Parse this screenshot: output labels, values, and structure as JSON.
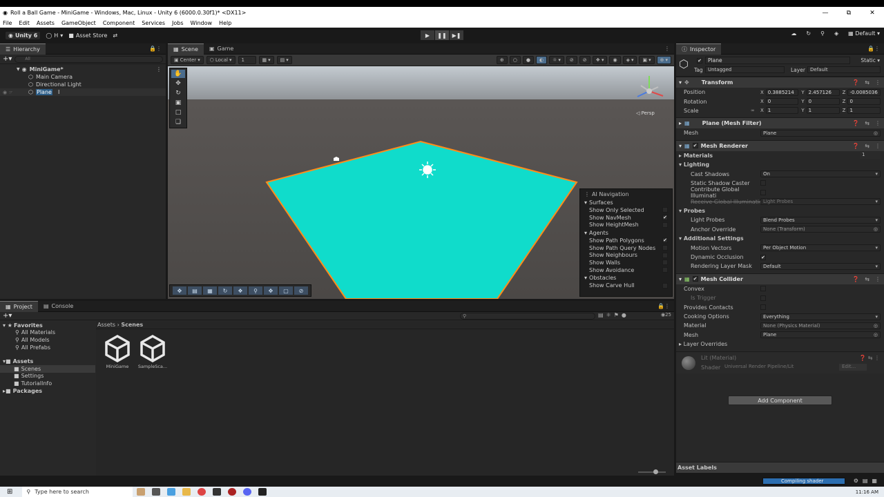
{
  "window": {
    "title": "Roll a Ball Game - MiniGame - Windows, Mac, Linux - Unity 6 (6000.0.30f1)* <DX11>",
    "min": "—",
    "max": "⧉",
    "close": "✕"
  },
  "menu": [
    "File",
    "Edit",
    "Assets",
    "GameObject",
    "Component",
    "Services",
    "Jobs",
    "Window",
    "Help"
  ],
  "toolbar": {
    "unity": "Unity 6",
    "account": "H",
    "asset_store": "Asset Store",
    "layout": "Default"
  },
  "hierarchy": {
    "tab": "Hierarchy",
    "search_placeholder": "All",
    "items": [
      {
        "label": "MiniGame*"
      },
      {
        "label": "Main Camera"
      },
      {
        "label": "Directional Light"
      },
      {
        "label": "Plane"
      }
    ]
  },
  "scene": {
    "tabs": [
      "Scene",
      "Game"
    ],
    "pivot": "Center",
    "space": "Local",
    "grid": "1",
    "persp": "◁ Persp"
  },
  "ainav": {
    "title": "AI Navigation",
    "surfaces": "Surfaces",
    "agents": "Agents",
    "obstacles": "Obstacles",
    "surface_opts": [
      {
        "label": "Show Only Selected",
        "checked": ""
      },
      {
        "label": "Show NavMesh",
        "checked": "✔"
      },
      {
        "label": "Show HeightMesh",
        "checked": ""
      }
    ],
    "agent_opts": [
      {
        "label": "Show Path Polygons",
        "checked": "✔"
      },
      {
        "label": "Show Path Query Nodes",
        "checked": ""
      },
      {
        "label": "Show Neighbours",
        "checked": ""
      },
      {
        "label": "Show Walls",
        "checked": ""
      },
      {
        "label": "Show Avoidance",
        "checked": ""
      }
    ],
    "obstacle_opts": [
      {
        "label": "Show Carve Hull",
        "checked": ""
      }
    ]
  },
  "inspector": {
    "tab": "Inspector",
    "object_name": "Plane",
    "static": "Static",
    "tag_label": "Tag",
    "tag": "Untagged",
    "layer_label": "Layer",
    "layer": "Default",
    "transform": {
      "title": "Transform",
      "position_label": "Position",
      "rotation_label": "Rotation",
      "scale_label": "Scale",
      "position": [
        "0.3885214",
        "2.457126",
        "-0.0085036"
      ],
      "rotation": [
        "0",
        "0",
        "0"
      ],
      "scale": [
        "1",
        "1",
        "1"
      ]
    },
    "mesh_filter": {
      "title": "Plane (Mesh Filter)",
      "mesh_label": "Mesh",
      "mesh": "Plane"
    },
    "mesh_renderer": {
      "title": "Mesh Renderer",
      "materials": "Materials",
      "materials_count": "1",
      "lighting": "Lighting",
      "cast_shadows_label": "Cast Shadows",
      "cast_shadows": "On",
      "static_shadow": "Static Shadow Caster",
      "contribute_gi": "Contribute Global Illuminati",
      "receive_gi_label": "Receive Global Illumination",
      "receive_gi": "Light Probes",
      "probes": "Probes",
      "light_probes_label": "Light Probes",
      "light_probes": "Blend Probes",
      "anchor_label": "Anchor Override",
      "anchor": "None (Transform)",
      "additional": "Additional Settings",
      "motion_label": "Motion Vectors",
      "motion": "Per Object Motion",
      "dynamic_occlusion": "Dynamic Occlusion",
      "rendering_mask_label": "Rendering Layer Mask",
      "rendering_mask": "Default"
    },
    "mesh_collider": {
      "title": "Mesh Collider",
      "convex": "Convex",
      "is_trigger": "Is Trigger",
      "provides_contacts": "Provides Contacts",
      "cooking_label": "Cooking Options",
      "cooking": "Everything",
      "material_label": "Material",
      "material": "None (Physics Material)",
      "mesh_label": "Mesh",
      "mesh": "Plane",
      "layer_overrides": "Layer Overrides"
    },
    "material": {
      "name": "Lit (Material)",
      "shader_label": "Shader",
      "shader": "Universal Render Pipeline/Lit",
      "edit": "Edit..."
    },
    "add_component": "Add Component",
    "asset_labels": "Asset Labels"
  },
  "project": {
    "tabs": [
      "Project",
      "Console"
    ],
    "tree": [
      {
        "label": "Favorites",
        "bold": true
      },
      {
        "label": "All Materials"
      },
      {
        "label": "All Models"
      },
      {
        "label": "All Prefabs"
      },
      {
        "label": "Assets",
        "bold": true
      },
      {
        "label": "Scenes"
      },
      {
        "label": "Settings"
      },
      {
        "label": "TutorialInfo"
      },
      {
        "label": "Packages",
        "bold": true
      }
    ],
    "breadcrumb": [
      "Assets",
      "Scenes"
    ],
    "count": "25",
    "assets": [
      "MiniGame",
      "SampleSca..."
    ]
  },
  "status": {
    "compiling": "Compiling shader"
  },
  "taskbar": {
    "search": "Type here to search",
    "time": "11:16 AM"
  },
  "colors": {
    "plane": "#10dccb",
    "plane_edge": "#ff8c1a",
    "selection": "#2c5d87",
    "progress": "#2c6eb0"
  }
}
